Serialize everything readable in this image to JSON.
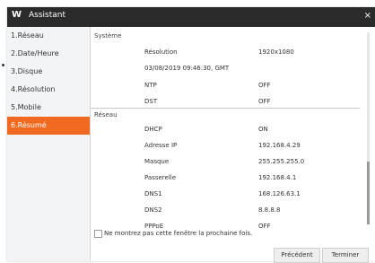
{
  "window": {
    "title": "Assistant",
    "logo": "W",
    "close_glyph": "×"
  },
  "sidebar": {
    "items": [
      {
        "label": "1.Réseau",
        "active": false
      },
      {
        "label": "2.Date/Heure",
        "active": false
      },
      {
        "label": "3.Disque",
        "active": false
      },
      {
        "label": "4.Résolution",
        "active": false
      },
      {
        "label": "5.Mobile",
        "active": false
      },
      {
        "label": "6.Résumé",
        "active": true
      }
    ]
  },
  "summary": {
    "system": {
      "heading": "Système",
      "rows": [
        {
          "label": "Résolution",
          "value": "1920x1080"
        },
        {
          "label": "03/08/2019 09:46:30, GMT",
          "value": ""
        },
        {
          "label": "NTP",
          "value": "OFF"
        },
        {
          "label": "DST",
          "value": "OFF"
        }
      ]
    },
    "network": {
      "heading": "Réseau",
      "rows": [
        {
          "label": "DHCP",
          "value": "ON"
        },
        {
          "label": "Adresse IP",
          "value": "192.168.4.29"
        },
        {
          "label": "Masque",
          "value": "255.255.255.0"
        },
        {
          "label": "Passerelle",
          "value": "192.168.4.1"
        },
        {
          "label": "DNS1",
          "value": "168.126.63.1"
        },
        {
          "label": "DNS2",
          "value": "8.8.8.8"
        },
        {
          "label": "PPPoE",
          "value": "OFF"
        }
      ]
    }
  },
  "footer": {
    "checkbox_label": "Ne montrez pas cette fenêtre la prochaine fois.",
    "prev_label": "Précédent",
    "finish_label": "Terminer"
  },
  "colors": {
    "accent": "#f26a21",
    "titlebar": "#2b2b2b"
  }
}
